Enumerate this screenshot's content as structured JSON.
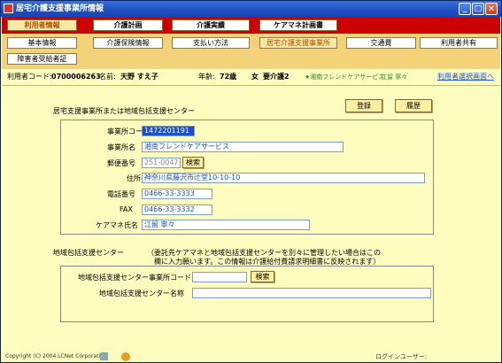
{
  "window": {
    "title": "居宅介護支援事業所情報",
    "min": "_",
    "max": "□",
    "close": "×"
  },
  "main_tabs": [
    "利用者情報",
    "介護計画",
    "介護実績",
    "ケアマネ計画書"
  ],
  "sub_tabs_row1": [
    "基本情報",
    "介護保険情報",
    "支払い方法",
    "居宅介護支援事業所",
    "交通費",
    "利用者共有"
  ],
  "sub_tabs_row2": [
    "障害者受給者証"
  ],
  "info": {
    "code_label": "利用者コード:",
    "code": "0700006263",
    "name_label": "名前:",
    "name": "天野 すえ子",
    "age_label": "年齢:",
    "age": "72歳",
    "sex": "女",
    "care_level": "要介護2",
    "office": "★湘南フレンドケアサービス",
    "manager": "江留 寧々",
    "select_link": "利用者選択画面へ"
  },
  "section1": {
    "title": "居宅支援事業所または地域包括支援センター",
    "register": "登録",
    "history": "履歴",
    "fields": {
      "office_code_label": "事業所コード",
      "office_code": "1472201191",
      "office_name_label": "事業所名",
      "office_name": "湘南フレンドケアサービス",
      "postal_label": "郵便番号",
      "postal": "251-0047",
      "search": "検索",
      "address_label": "住所",
      "address": "神奈川県藤沢市辻堂10-10-10",
      "phone_label": "電話番号",
      "phone": "0466-33-3333",
      "fax_label": "FAX",
      "fax": "0466-33-3332",
      "caremgr_label": "ケアマネ氏名",
      "caremgr": "江留 寧々"
    }
  },
  "section2": {
    "title": "地域包括支援センター",
    "note_line1": "（委託先ケアマネと地域包括支援センターを別々に管理したい場合はこの",
    "note_line2": "欄に入力願います。この情報は介護給付費請求明細書に反映されます）",
    "code_label": "地域包括支援センター事業所コード",
    "code": "",
    "search": "検索",
    "name_label": "地域包括支援センター名称",
    "name": ""
  },
  "status": {
    "copyright": "Copyright (C) 2004 LCNet Corporation",
    "login_label": "ログインユーザー:",
    "login_user": ""
  }
}
